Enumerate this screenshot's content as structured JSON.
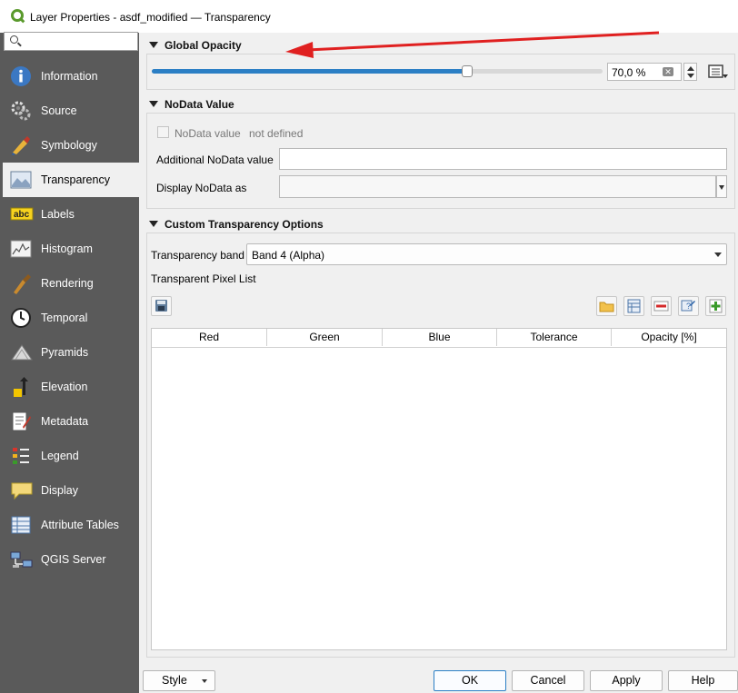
{
  "window": {
    "title": "Layer Properties - asdf_modified — Transparency"
  },
  "search": {
    "placeholder": ""
  },
  "sidebar": {
    "items": [
      {
        "label": "Information",
        "icon": "information-icon"
      },
      {
        "label": "Source",
        "icon": "source-icon"
      },
      {
        "label": "Symbology",
        "icon": "symbology-icon"
      },
      {
        "label": "Transparency",
        "icon": "transparency-icon",
        "active": true
      },
      {
        "label": "Labels",
        "icon": "labels-icon"
      },
      {
        "label": "Histogram",
        "icon": "histogram-icon"
      },
      {
        "label": "Rendering",
        "icon": "rendering-icon"
      },
      {
        "label": "Temporal",
        "icon": "temporal-icon"
      },
      {
        "label": "Pyramids",
        "icon": "pyramids-icon"
      },
      {
        "label": "Elevation",
        "icon": "elevation-icon"
      },
      {
        "label": "Metadata",
        "icon": "metadata-icon"
      },
      {
        "label": "Legend",
        "icon": "legend-icon"
      },
      {
        "label": "Display",
        "icon": "display-icon"
      },
      {
        "label": "Attribute Tables",
        "icon": "attribute-tables-icon"
      },
      {
        "label": "QGIS Server",
        "icon": "qgis-server-icon"
      }
    ],
    "labels_icon_text": "abc"
  },
  "global_opacity": {
    "header": "Global Opacity",
    "value_text": "70,0 %",
    "fraction": 0.7
  },
  "nodata": {
    "header": "NoData Value",
    "checkbox_label": "NoData value",
    "not_defined": "not defined",
    "additional_label": "Additional NoData value",
    "additional_value": "",
    "display_label": "Display NoData as"
  },
  "custom": {
    "header": "Custom Transparency Options",
    "band_label": "Transparency band",
    "band_value": "Band 4 (Alpha)",
    "pixel_list_label": "Transparent Pixel List",
    "columns": [
      "Red",
      "Green",
      "Blue",
      "Tolerance",
      "Opacity [%]"
    ]
  },
  "buttons": {
    "style": "Style",
    "ok": "OK",
    "cancel": "Cancel",
    "apply": "Apply",
    "help": "Help"
  },
  "colors": {
    "accent": "#2b7fc5",
    "sidebar": "#5a5a5a",
    "arrow": "#e02020"
  }
}
